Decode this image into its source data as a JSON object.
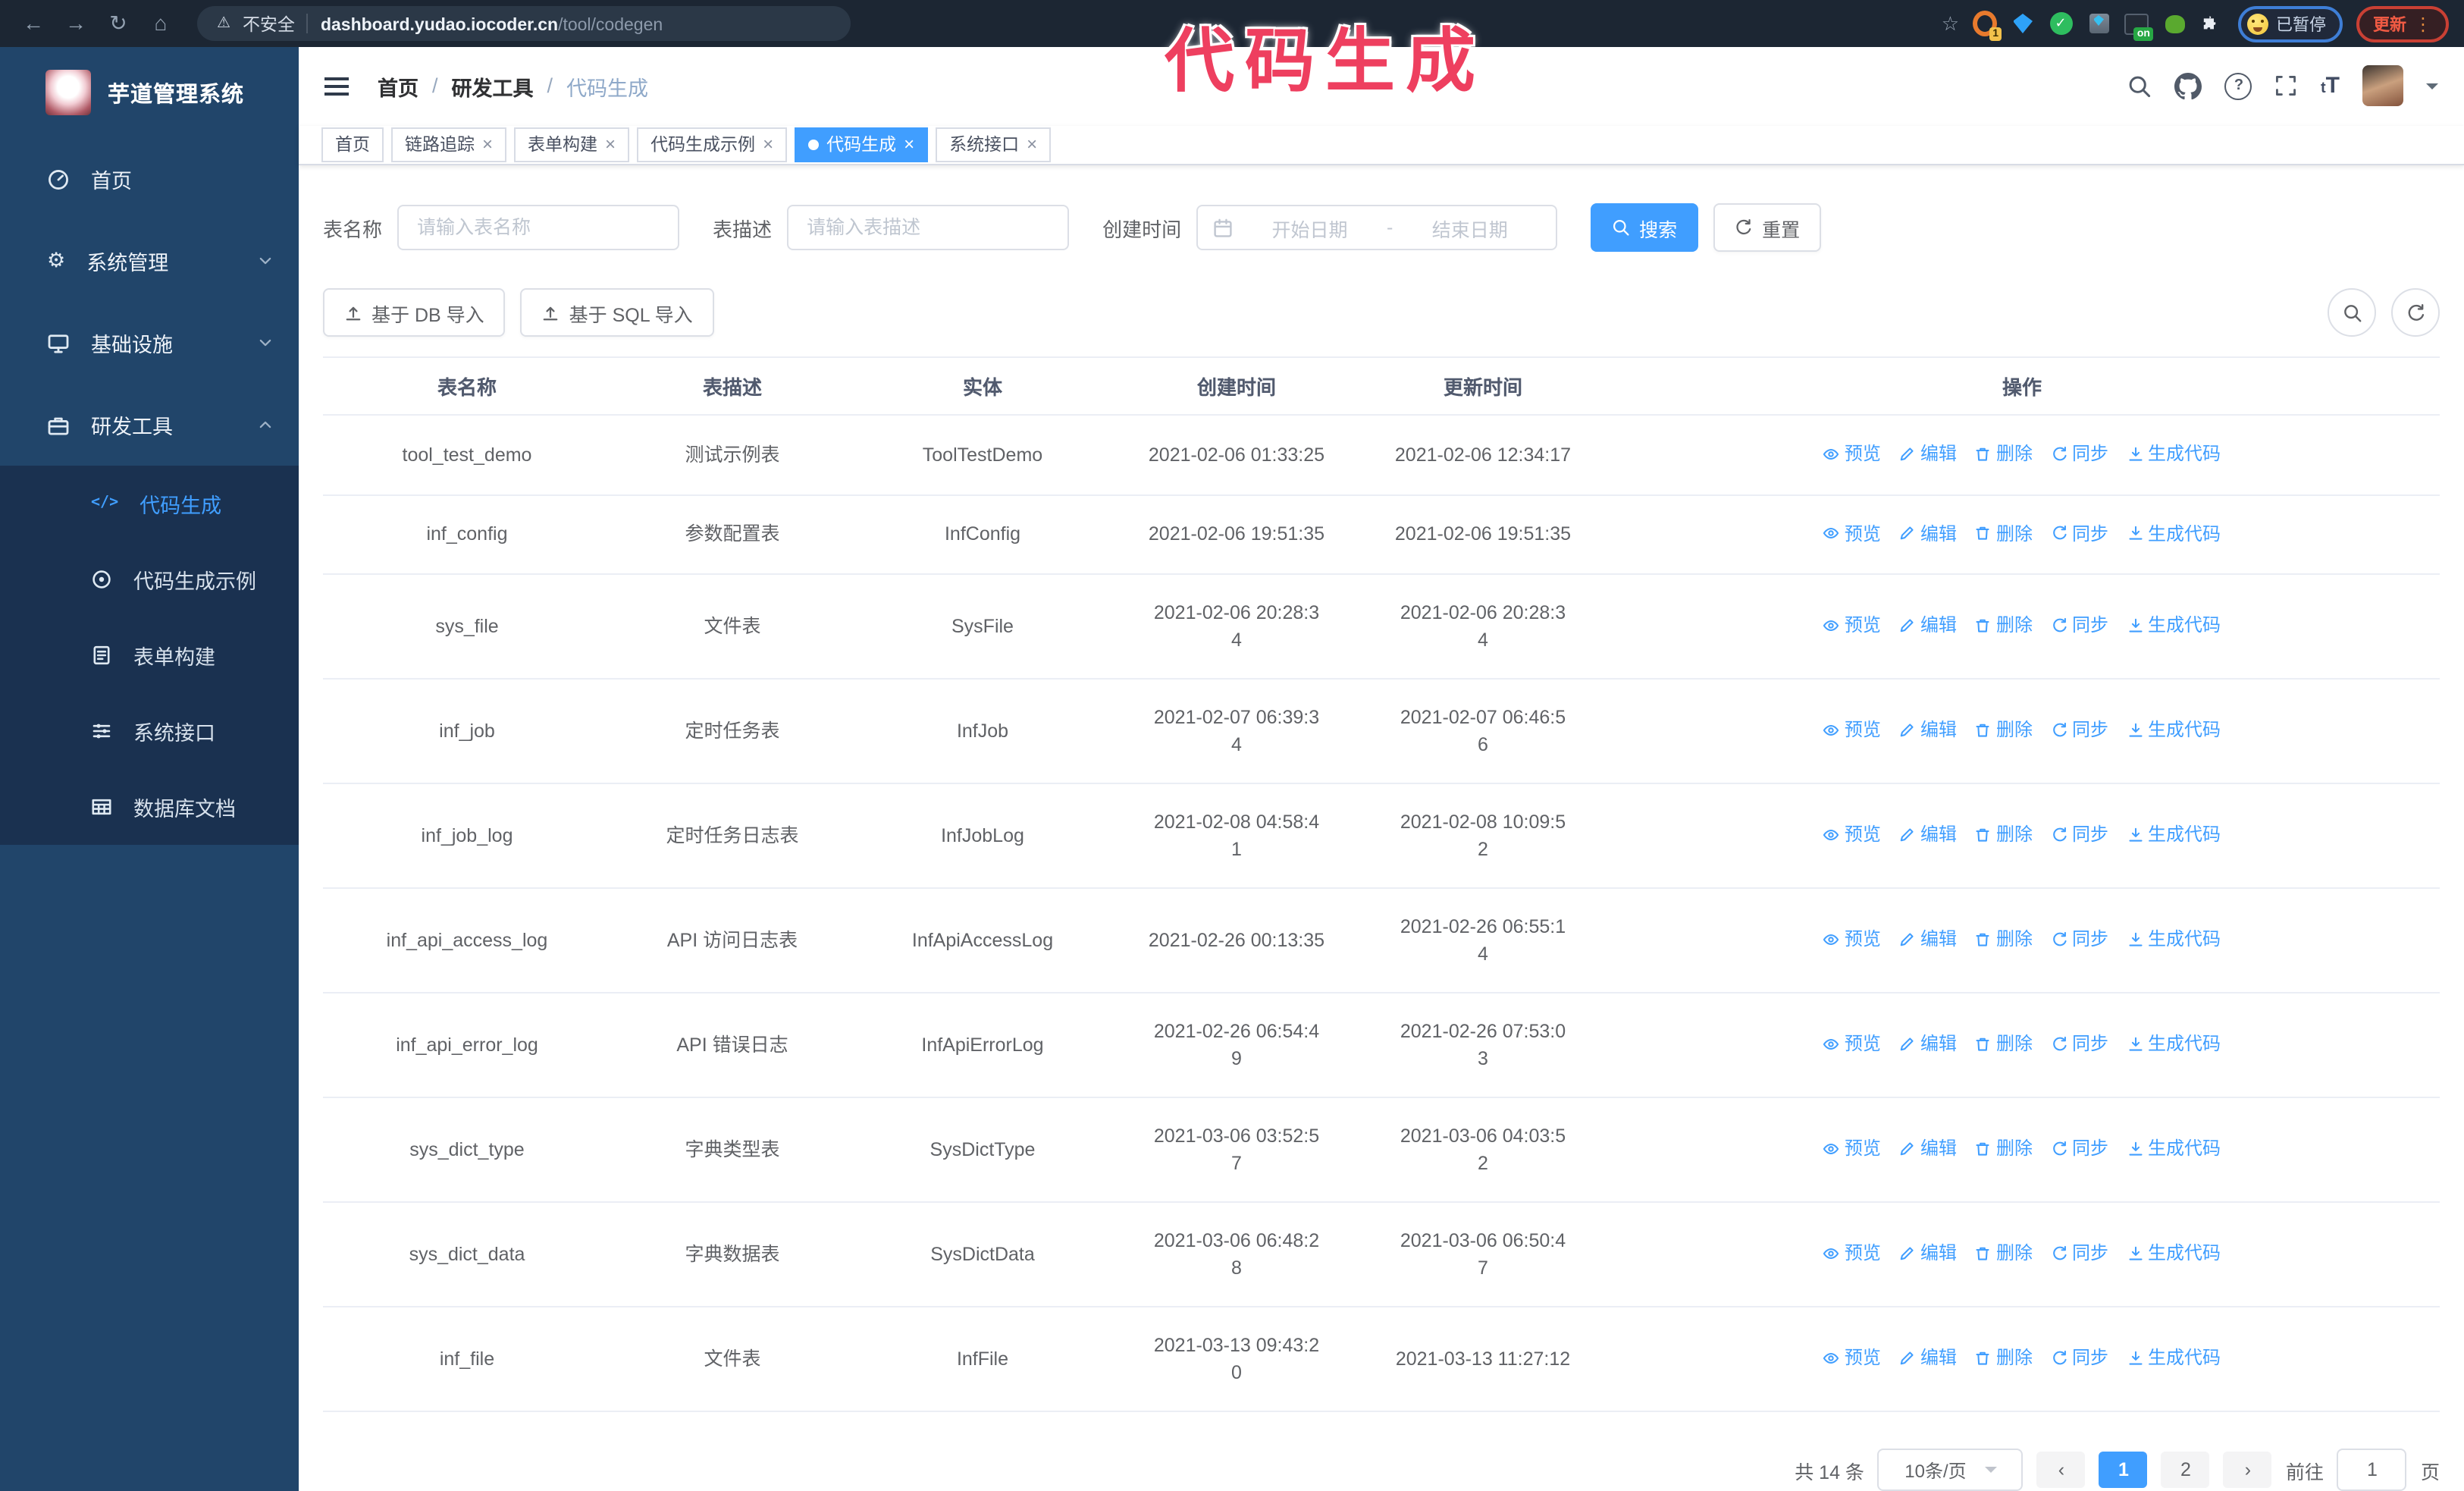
{
  "colors": {
    "accent": "#409eff",
    "overlay_pink": "#ee3f5f",
    "sidebar_bg": "#21456a",
    "submenu_bg": "#1a3150"
  },
  "overlay": {
    "title": "代码生成"
  },
  "browser": {
    "security_label": "不安全",
    "url_domain": "dashboard.yudao.iocoder.cn",
    "url_path": "/tool/codegen",
    "paused_label": "已暂停",
    "update_label": "更新",
    "extensions": [
      {
        "icon": "orange-extension-icon",
        "badge": "1"
      },
      {
        "icon": "blue-gem-extension-icon",
        "badge": ""
      },
      {
        "icon": "green-check-extension-icon",
        "badge": ""
      },
      {
        "icon": "grid-extension-icon",
        "badge": ""
      },
      {
        "icon": "dark-on-extension-icon",
        "badge": "on"
      },
      {
        "icon": "green-animal-extension-icon",
        "badge": ""
      },
      {
        "icon": "puzzle-extensions-icon",
        "badge": ""
      }
    ]
  },
  "sidebar": {
    "logo_title": "芋道管理系统",
    "items": [
      {
        "label": "首页",
        "icon": "dashboard-icon",
        "chevron": ""
      },
      {
        "label": "系统管理",
        "icon": "gear-icon",
        "chevron": "down"
      },
      {
        "label": "基础设施",
        "icon": "monitor-icon",
        "chevron": "down"
      },
      {
        "label": "研发工具",
        "icon": "toolbox-icon",
        "chevron": "up"
      }
    ],
    "submenu": [
      {
        "label": "代码生成",
        "icon": "code-icon",
        "active": true
      },
      {
        "label": "代码生成示例",
        "icon": "example-icon",
        "active": false
      },
      {
        "label": "表单构建",
        "icon": "form-icon",
        "active": false
      },
      {
        "label": "系统接口",
        "icon": "sliders-icon",
        "active": false
      },
      {
        "label": "数据库文档",
        "icon": "table-grid-icon",
        "active": false
      }
    ]
  },
  "header": {
    "breadcrumb": [
      "首页",
      "研发工具",
      "代码生成"
    ]
  },
  "tags": [
    {
      "label": "首页",
      "closable": false,
      "active": false
    },
    {
      "label": "链路追踪",
      "closable": true,
      "active": false
    },
    {
      "label": "表单构建",
      "closable": true,
      "active": false
    },
    {
      "label": "代码生成示例",
      "closable": true,
      "active": false
    },
    {
      "label": "代码生成",
      "closable": true,
      "active": true
    },
    {
      "label": "系统接口",
      "closable": true,
      "active": false
    }
  ],
  "search": {
    "name_label": "表名称",
    "name_placeholder": "请输入表名称",
    "desc_label": "表描述",
    "desc_placeholder": "请输入表描述",
    "time_label": "创建时间",
    "start_placeholder": "开始日期",
    "separator": "-",
    "end_placeholder": "结束日期",
    "search_label": "搜索",
    "reset_label": "重置"
  },
  "toolbar": {
    "import_db_label": "基于 DB 导入",
    "import_sql_label": "基于 SQL 导入"
  },
  "table": {
    "columns": [
      "表名称",
      "表描述",
      "实体",
      "创建时间",
      "更新时间",
      "操作"
    ],
    "actions": [
      {
        "label": "预览",
        "icon": "eye-icon"
      },
      {
        "label": "编辑",
        "icon": "edit-icon"
      },
      {
        "label": "删除",
        "icon": "delete-icon"
      },
      {
        "label": "同步",
        "icon": "sync-icon"
      },
      {
        "label": "生成代码",
        "icon": "download-icon"
      }
    ],
    "rows": [
      {
        "name": "tool_test_demo",
        "desc": "测试示例表",
        "entity": "ToolTestDemo",
        "created": "2021-02-06 01:33:25",
        "updated": "2021-02-06 12:34:17"
      },
      {
        "name": "inf_config",
        "desc": "参数配置表",
        "entity": "InfConfig",
        "created": "2021-02-06 19:51:35",
        "updated": "2021-02-06 19:51:35"
      },
      {
        "name": "sys_file",
        "desc": "文件表",
        "entity": "SysFile",
        "created": "2021-02-06 20:28:3\n4",
        "updated": "2021-02-06 20:28:3\n4"
      },
      {
        "name": "inf_job",
        "desc": "定时任务表",
        "entity": "InfJob",
        "created": "2021-02-07 06:39:3\n4",
        "updated": "2021-02-07 06:46:5\n6"
      },
      {
        "name": "inf_job_log",
        "desc": "定时任务日志表",
        "entity": "InfJobLog",
        "created": "2021-02-08 04:58:4\n1",
        "updated": "2021-02-08 10:09:5\n2"
      },
      {
        "name": "inf_api_access_log",
        "desc": "API 访问日志表",
        "entity": "InfApiAccessLog",
        "created": "2021-02-26 00:13:35",
        "updated": "2021-02-26 06:55:1\n4"
      },
      {
        "name": "inf_api_error_log",
        "desc": "API 错误日志",
        "entity": "InfApiErrorLog",
        "created": "2021-02-26 06:54:4\n9",
        "updated": "2021-02-26 07:53:0\n3"
      },
      {
        "name": "sys_dict_type",
        "desc": "字典类型表",
        "entity": "SysDictType",
        "created": "2021-03-06 03:52:5\n7",
        "updated": "2021-03-06 04:03:5\n2"
      },
      {
        "name": "sys_dict_data",
        "desc": "字典数据表",
        "entity": "SysDictData",
        "created": "2021-03-06 06:48:2\n8",
        "updated": "2021-03-06 06:50:4\n7"
      },
      {
        "name": "inf_file",
        "desc": "文件表",
        "entity": "InfFile",
        "created": "2021-03-13 09:43:2\n0",
        "updated": "2021-03-13 11:27:12"
      }
    ]
  },
  "pagination": {
    "total_label": "共 14 条",
    "page_size": "10条/页",
    "pages": [
      {
        "label": "1",
        "active": true
      },
      {
        "label": "2",
        "active": false
      }
    ],
    "goto_label": "前往",
    "goto_value": "1",
    "page_label": "页"
  }
}
